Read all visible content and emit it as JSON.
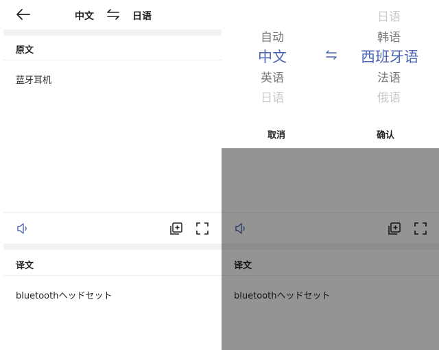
{
  "left": {
    "header": {
      "source_lang": "中文",
      "target_lang": "日语"
    },
    "original": {
      "title": "原文",
      "text": "蓝牙耳机"
    },
    "translation": {
      "title": "译文",
      "text": "bluetoothヘッドセット"
    }
  },
  "right": {
    "picker": {
      "source_options": [
        "自动",
        "中文",
        "英语",
        "日语"
      ],
      "target_options": [
        "日语",
        "韩语",
        "西班牙语",
        "法语",
        "俄语"
      ],
      "cancel": "取消",
      "confirm": "确认"
    },
    "translation": {
      "title": "译文",
      "text": "bluetoothヘッドセット"
    }
  },
  "colors": {
    "accent": "#4a63b5",
    "overlay": "#9e9e9e"
  }
}
